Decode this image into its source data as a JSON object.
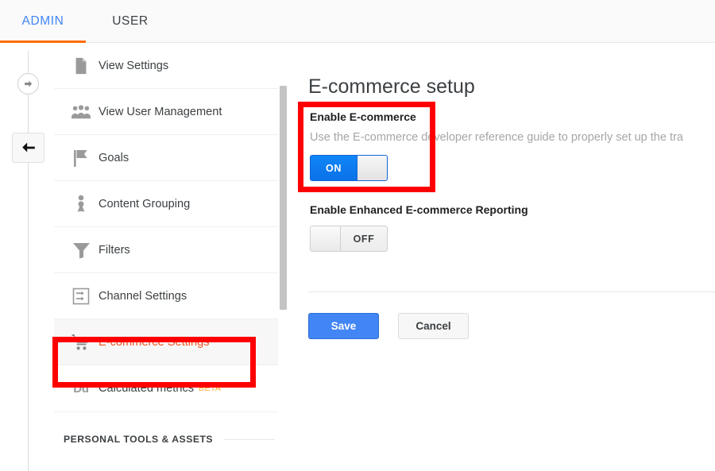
{
  "tabs": [
    {
      "id": "admin",
      "label": "ADMIN",
      "active": true
    },
    {
      "id": "user",
      "label": "USER",
      "active": false
    }
  ],
  "rail": {
    "forward_icon": "circle-arrow-right-icon",
    "back_icon": "arrow-left-icon"
  },
  "sidebar": {
    "items": [
      {
        "label": "View Settings",
        "icon": "document-icon",
        "active": false
      },
      {
        "label": "View User Management",
        "icon": "people-group-icon",
        "active": false
      },
      {
        "label": "Goals",
        "icon": "flag-icon",
        "active": false
      },
      {
        "label": "Content Grouping",
        "icon": "content-grouping-icon",
        "active": false
      },
      {
        "label": "Filters",
        "icon": "funnel-icon",
        "active": false
      },
      {
        "label": "Channel Settings",
        "icon": "channel-arrows-icon",
        "active": false
      },
      {
        "label": "E-commerce Settings",
        "icon": "shopping-cart-icon",
        "active": true
      },
      {
        "label": "Calculated metrics",
        "icon": "dd-text-icon",
        "badge": "BETA",
        "active": false
      }
    ],
    "section_header": "PERSONAL TOOLS & ASSETS"
  },
  "main": {
    "title": "E-commerce setup",
    "enable_ecommerce": {
      "label": "Enable E-commerce",
      "description": "Use the E-commerce developer reference guide to properly set up the tra",
      "toggle_state": "ON"
    },
    "enhanced_reporting": {
      "label": "Enable Enhanced E-commerce Reporting",
      "toggle_state": "OFF"
    },
    "buttons": {
      "save": "Save",
      "cancel": "Cancel"
    }
  },
  "colors": {
    "admin_tab": "#4285f4",
    "tab_underline": "#ff6d00",
    "active_nav": "#f4511e",
    "beta_badge": "#f9a825",
    "toggle_on": "#0c7cf4",
    "save_button": "#4285f4",
    "annotation": "#ff0000"
  }
}
